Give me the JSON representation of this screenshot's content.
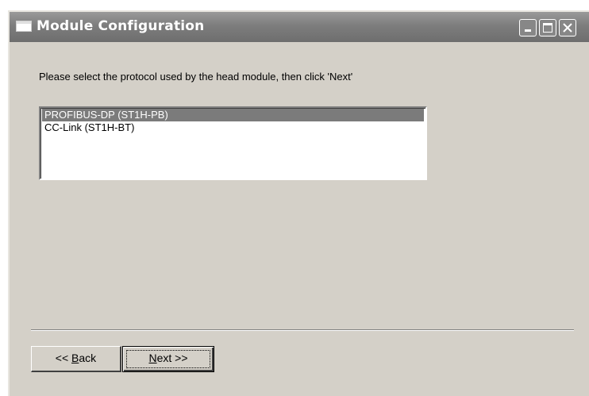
{
  "window": {
    "title": "Module Configuration",
    "controls": [
      "minimize",
      "maximize",
      "close"
    ]
  },
  "prompt": "Please select the protocol used by the head module,  then click 'Next'",
  "protocol_list": {
    "items": [
      {
        "label": "PROFIBUS-DP (ST1H-PB)",
        "selected": true
      },
      {
        "label": "CC-Link (ST1H-BT)",
        "selected": false
      }
    ]
  },
  "buttons": {
    "back": {
      "prefix": "<< ",
      "mnemonic": "B",
      "rest": "ack"
    },
    "next": {
      "mnemonic": "N",
      "rest": "ext >>"
    }
  },
  "colors": {
    "titlebar": "#7d7d7d",
    "face": "#d4d0c8",
    "selection": "#7b7b7b"
  }
}
